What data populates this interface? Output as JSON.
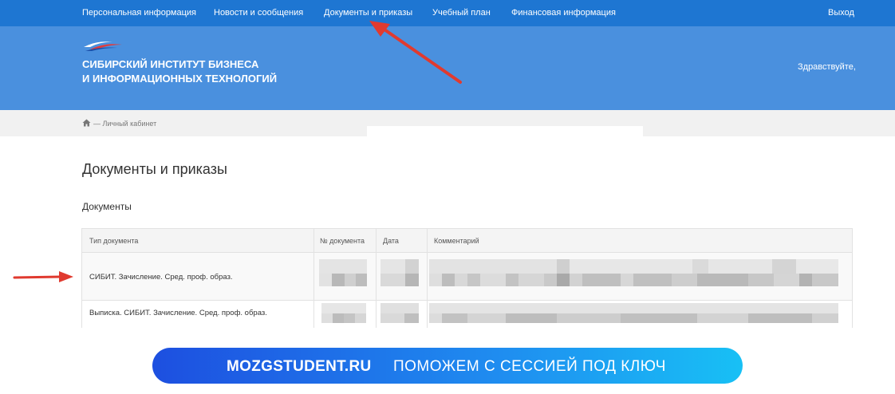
{
  "nav": {
    "items": [
      {
        "label": "Персональная информация"
      },
      {
        "label": "Новости и сообщения"
      },
      {
        "label": "Документы и приказы"
      },
      {
        "label": "Учебный план"
      },
      {
        "label": "Финансовая информация"
      }
    ],
    "logout": "Выход"
  },
  "header": {
    "logo_line1": "СИБИРСКИЙ ИНСТИТУТ БИЗНЕСА",
    "logo_line2": "И ИНФОРМАЦИОННЫХ ТЕХНОЛОГИЙ",
    "greeting": "Здравствуйте,"
  },
  "breadcrumb": {
    "text": "— Личный кабинет",
    "icon": "home-icon"
  },
  "page": {
    "title": "Документы и приказы",
    "section": "Документы"
  },
  "table": {
    "columns": [
      "Тип документа",
      "№ документа",
      "Дата",
      "Комментарий"
    ],
    "rows": [
      {
        "type": "СИБИТ. Зачисление. Сред. проф. образ."
      },
      {
        "type": "Выписка. СИБИТ. Зачисление. Сред. проф. образ."
      }
    ]
  },
  "banner": {
    "brand": "MOZGSTUDENT.RU",
    "slogan": "ПОМОЖЕМ С СЕССИЕЙ ПОД КЛЮЧ"
  },
  "colors": {
    "nav_bg": "#1e76d2",
    "header_bg": "#4a90de",
    "arrow": "#e03a2f",
    "banner_start": "#1d4fe0",
    "banner_end": "#18c0f5"
  }
}
